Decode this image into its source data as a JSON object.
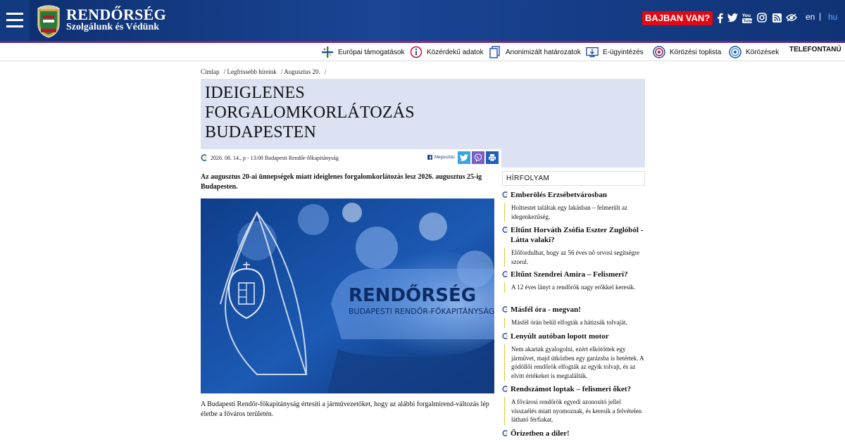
{
  "header": {
    "brand_title": "RENDŐRSÉG",
    "brand_subtitle": "Szolgálunk és Védünk",
    "alert_button": "BAJBAN VAN?",
    "languages": [
      {
        "label": "en",
        "active": false
      },
      {
        "label": "hu",
        "active": true
      }
    ],
    "social_icons": [
      "facebook-icon",
      "twitter-icon",
      "youtube-icon",
      "instagram-icon",
      "rss-icon",
      "accessibility-icon"
    ]
  },
  "subnav": {
    "items": [
      {
        "label": "Európai támogatások",
        "icon": "eu-support-icon"
      },
      {
        "label": "Közérdekű adatok",
        "icon": "info-icon"
      },
      {
        "label": "Anonimizált határozatok",
        "icon": "document-icon"
      },
      {
        "label": "E-ügyintézés",
        "icon": "download-icon"
      },
      {
        "label": "Körözési toplista",
        "icon": "target-icon"
      },
      {
        "label": "Körözések",
        "icon": "target-icon"
      }
    ],
    "phonebook": "TELEFONTANÚ"
  },
  "breadcrumb": [
    "Címlap",
    "/ Legfrissebb híreink",
    "/ Augusztus 20.",
    "/"
  ],
  "article": {
    "title_lines": [
      "IDEIGLENES",
      "FORGALOMKORLÁTOZÁS",
      "BUDAPESTEN"
    ],
    "meta": "2026. 08. 14., p - 13:08 Budapesti Rendőr-főkapitányság",
    "share_label": "Megosztás",
    "lead": "Az augusztus 20-ai ünnepségek miatt ideiglenes forgalomkorlátozás lesz 2026. augusztus 25-ig Budapesten.",
    "image_title": "RENDŐRSÉG",
    "image_subtitle": "BUDAPESTI RENDŐR-FŐKAPITÁNYSÁG",
    "caption": "A Budapesti Rendőr-főkapitányság értesíti a járművezetőket, hogy az alábbi forgalmirend-változás lép életbe a főváros területén."
  },
  "feed": {
    "heading": "HÍRFOLYAM",
    "items": [
      {
        "title": "Emberölés Erzsébetvárosban",
        "text": "Holttestet találtak egy lakásban – felmerült az idegenkezűség."
      },
      {
        "title": "Eltűnt Horváth Zsófia Eszter Zuglóból - Látta valaki?",
        "text": "Előfordulhat, hogy az 56 éves nő orvosi segítségre szorul."
      },
      {
        "title": "Eltűnt Szendrei Amira – Felismeri?",
        "text": "A 12 éves lányt a rendőrök nagy erőkkel keresik."
      },
      {
        "title": "Másfél óra - megvan!",
        "text": "Másfél órán belül elfogták a hátizsák tolvaját."
      },
      {
        "title": "Lenyúlt autóban lopott motor",
        "text": "Nem akartak gyalogolni, ezért elkötöttek egy járművet, majd útközben egy garázsba is betértek. A gödöllői rendőrök elfogták az egyik tolvajt, és az elvitt értékeket is megtalálták."
      },
      {
        "title": "Rendszámot loptak – felismeri őket?",
        "text": "A fővárosi rendőrök egyedi azonosító jellel visszaélés miatt nyomoznak, és keresik a felvételen látható férfiakat."
      },
      {
        "title": "Őrizetben a díler!",
        "text": ""
      }
    ]
  },
  "colors": {
    "header_blue": "#1a4595",
    "alert_red": "#e30613",
    "title_bg": "#dde2f3",
    "feed_accent": "#e8c63a"
  }
}
